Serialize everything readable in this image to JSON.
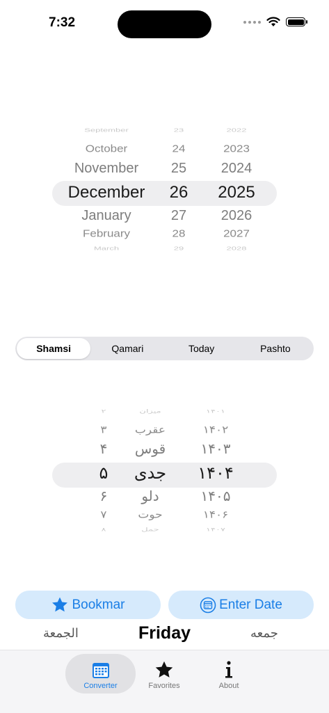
{
  "status": {
    "time": "7:32"
  },
  "gregorian_picker": {
    "months": [
      "September",
      "October",
      "November",
      "December",
      "January",
      "February",
      "March"
    ],
    "days": [
      "23",
      "24",
      "25",
      "26",
      "27",
      "28",
      "29"
    ],
    "years": [
      "2022",
      "2023",
      "2024",
      "2025",
      "2026",
      "2027",
      "2028"
    ],
    "selected_index": 3
  },
  "segment": {
    "items": [
      "Shamsi",
      "Qamari",
      "Today",
      "Pashto"
    ],
    "selected": "Shamsi"
  },
  "shamsi_picker": {
    "days": [
      "۲",
      "۳",
      "۴",
      "۵",
      "۶",
      "۷",
      "۸"
    ],
    "months": [
      "میزان",
      "عقرب",
      "قوس",
      "جدی",
      "دلو",
      "حوت",
      "حمل"
    ],
    "years": [
      "۱۴۰۱",
      "۱۴۰۲",
      "۱۴۰۳",
      "۱۴۰۴",
      "۱۴۰۵",
      "۱۴۰۶",
      "۱۴۰۷"
    ],
    "selected_index": 3
  },
  "actions": {
    "bookmark_label": "Bookmar",
    "enter_date_label": "Enter Date"
  },
  "weekday": {
    "arabic": "الجمعة",
    "english": "Friday",
    "dari": "جمعه"
  },
  "tabbar": {
    "items": [
      {
        "label": "Converter",
        "icon": "calendar-icon",
        "active": true
      },
      {
        "label": "Favorites",
        "icon": "star-icon",
        "active": false
      },
      {
        "label": "About",
        "icon": "info-icon",
        "active": false
      }
    ]
  },
  "colors": {
    "accent": "#1a7ee6",
    "button_bg": "#d6eafc"
  }
}
